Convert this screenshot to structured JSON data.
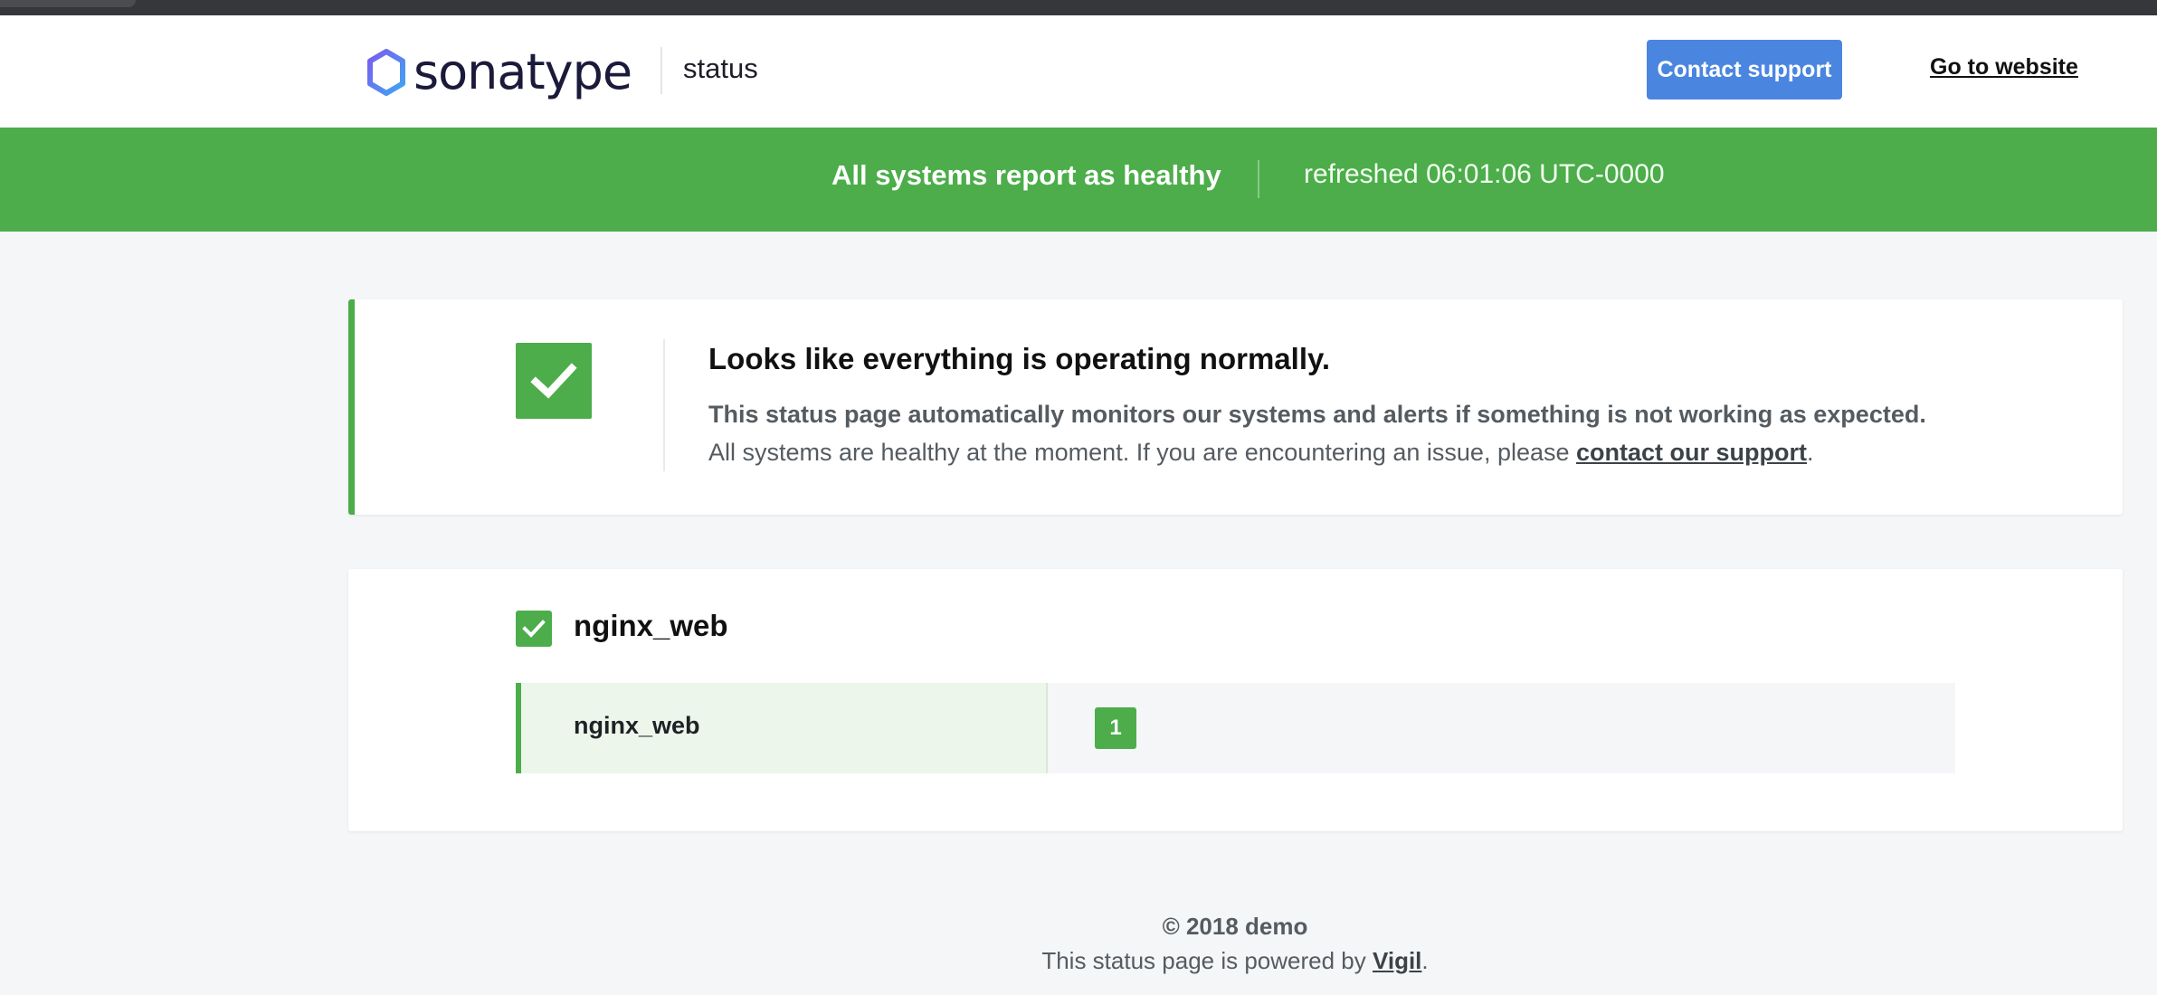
{
  "header": {
    "logo_text": "sonatype",
    "section_label": "status",
    "contact_button_label": "Contact support",
    "website_link_label": "Go to website"
  },
  "banner": {
    "status_text": "All systems report as healthy",
    "refreshed_text": "refreshed 06:01:06 UTC-0000"
  },
  "summary": {
    "title": "Looks like everything is operating normally.",
    "line1": "This status page automatically monitors our systems and alerts if something is not working as expected.",
    "line2_prefix": "All systems are healthy at the moment. If you are encountering an issue, please ",
    "line2_link": "contact our support",
    "line2_suffix": "."
  },
  "services": {
    "group_name": "nginx_web",
    "nodes": [
      {
        "label": "nginx_web",
        "replicas": [
          "1"
        ]
      }
    ]
  },
  "footer": {
    "copyright": "© 2018 demo",
    "powered_prefix": "This status page is powered by ",
    "powered_link": "Vigil",
    "powered_suffix": "."
  },
  "colors": {
    "healthy": "#4cad4a",
    "accent_button": "#4a86e0",
    "background": "#f4f6f8",
    "brand_text": "#1b1a3a"
  },
  "icons": [
    "sonatype-logo-icon",
    "check-icon",
    "check-icon-small"
  ]
}
